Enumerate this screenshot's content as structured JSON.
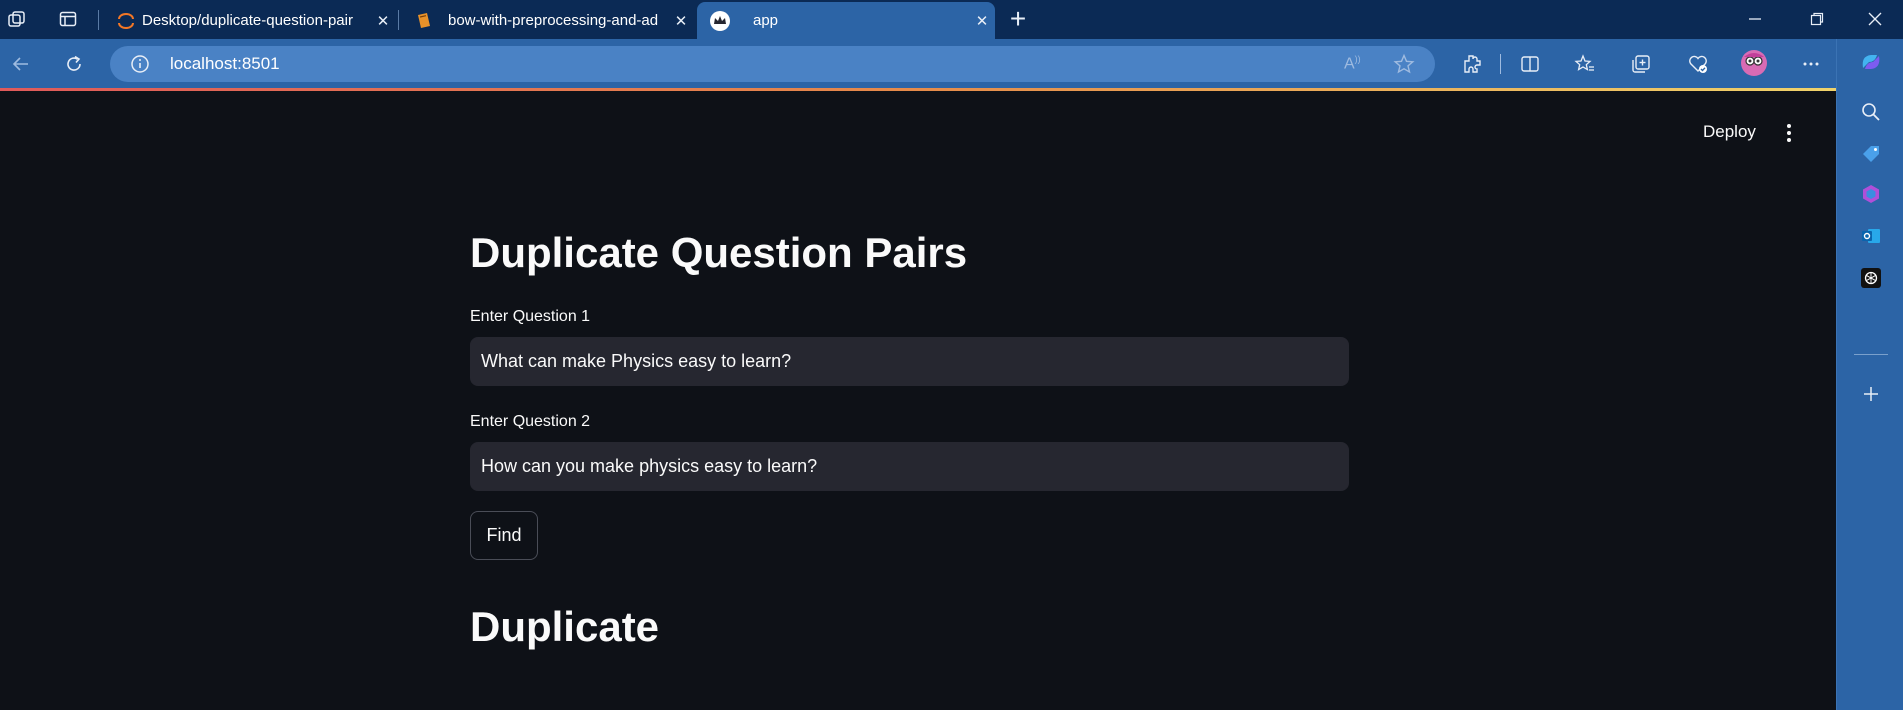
{
  "browser": {
    "tabs": [
      {
        "title": "Desktop/duplicate-question-pair",
        "icon": "jupyter-icon"
      },
      {
        "title": "bow-with-preprocessing-and-ad",
        "icon": "notebook-icon"
      },
      {
        "title": "app",
        "icon": "streamlit-crown-icon",
        "active": true
      }
    ],
    "tab_close": "✕",
    "new_tab": "+",
    "url": "localhost:8501",
    "accent_color": "#2c64a6"
  },
  "app": {
    "deploy_label": "Deploy",
    "title": "Duplicate Question Pairs",
    "question1_label": "Enter Question 1",
    "question1_value": "What can make Physics easy to learn?",
    "question2_label": "Enter Question 2",
    "question2_value": "How can you make physics easy to learn?",
    "find_label": "Find",
    "result": "Duplicate",
    "background_color": "#0e1117",
    "input_color": "#262730"
  }
}
